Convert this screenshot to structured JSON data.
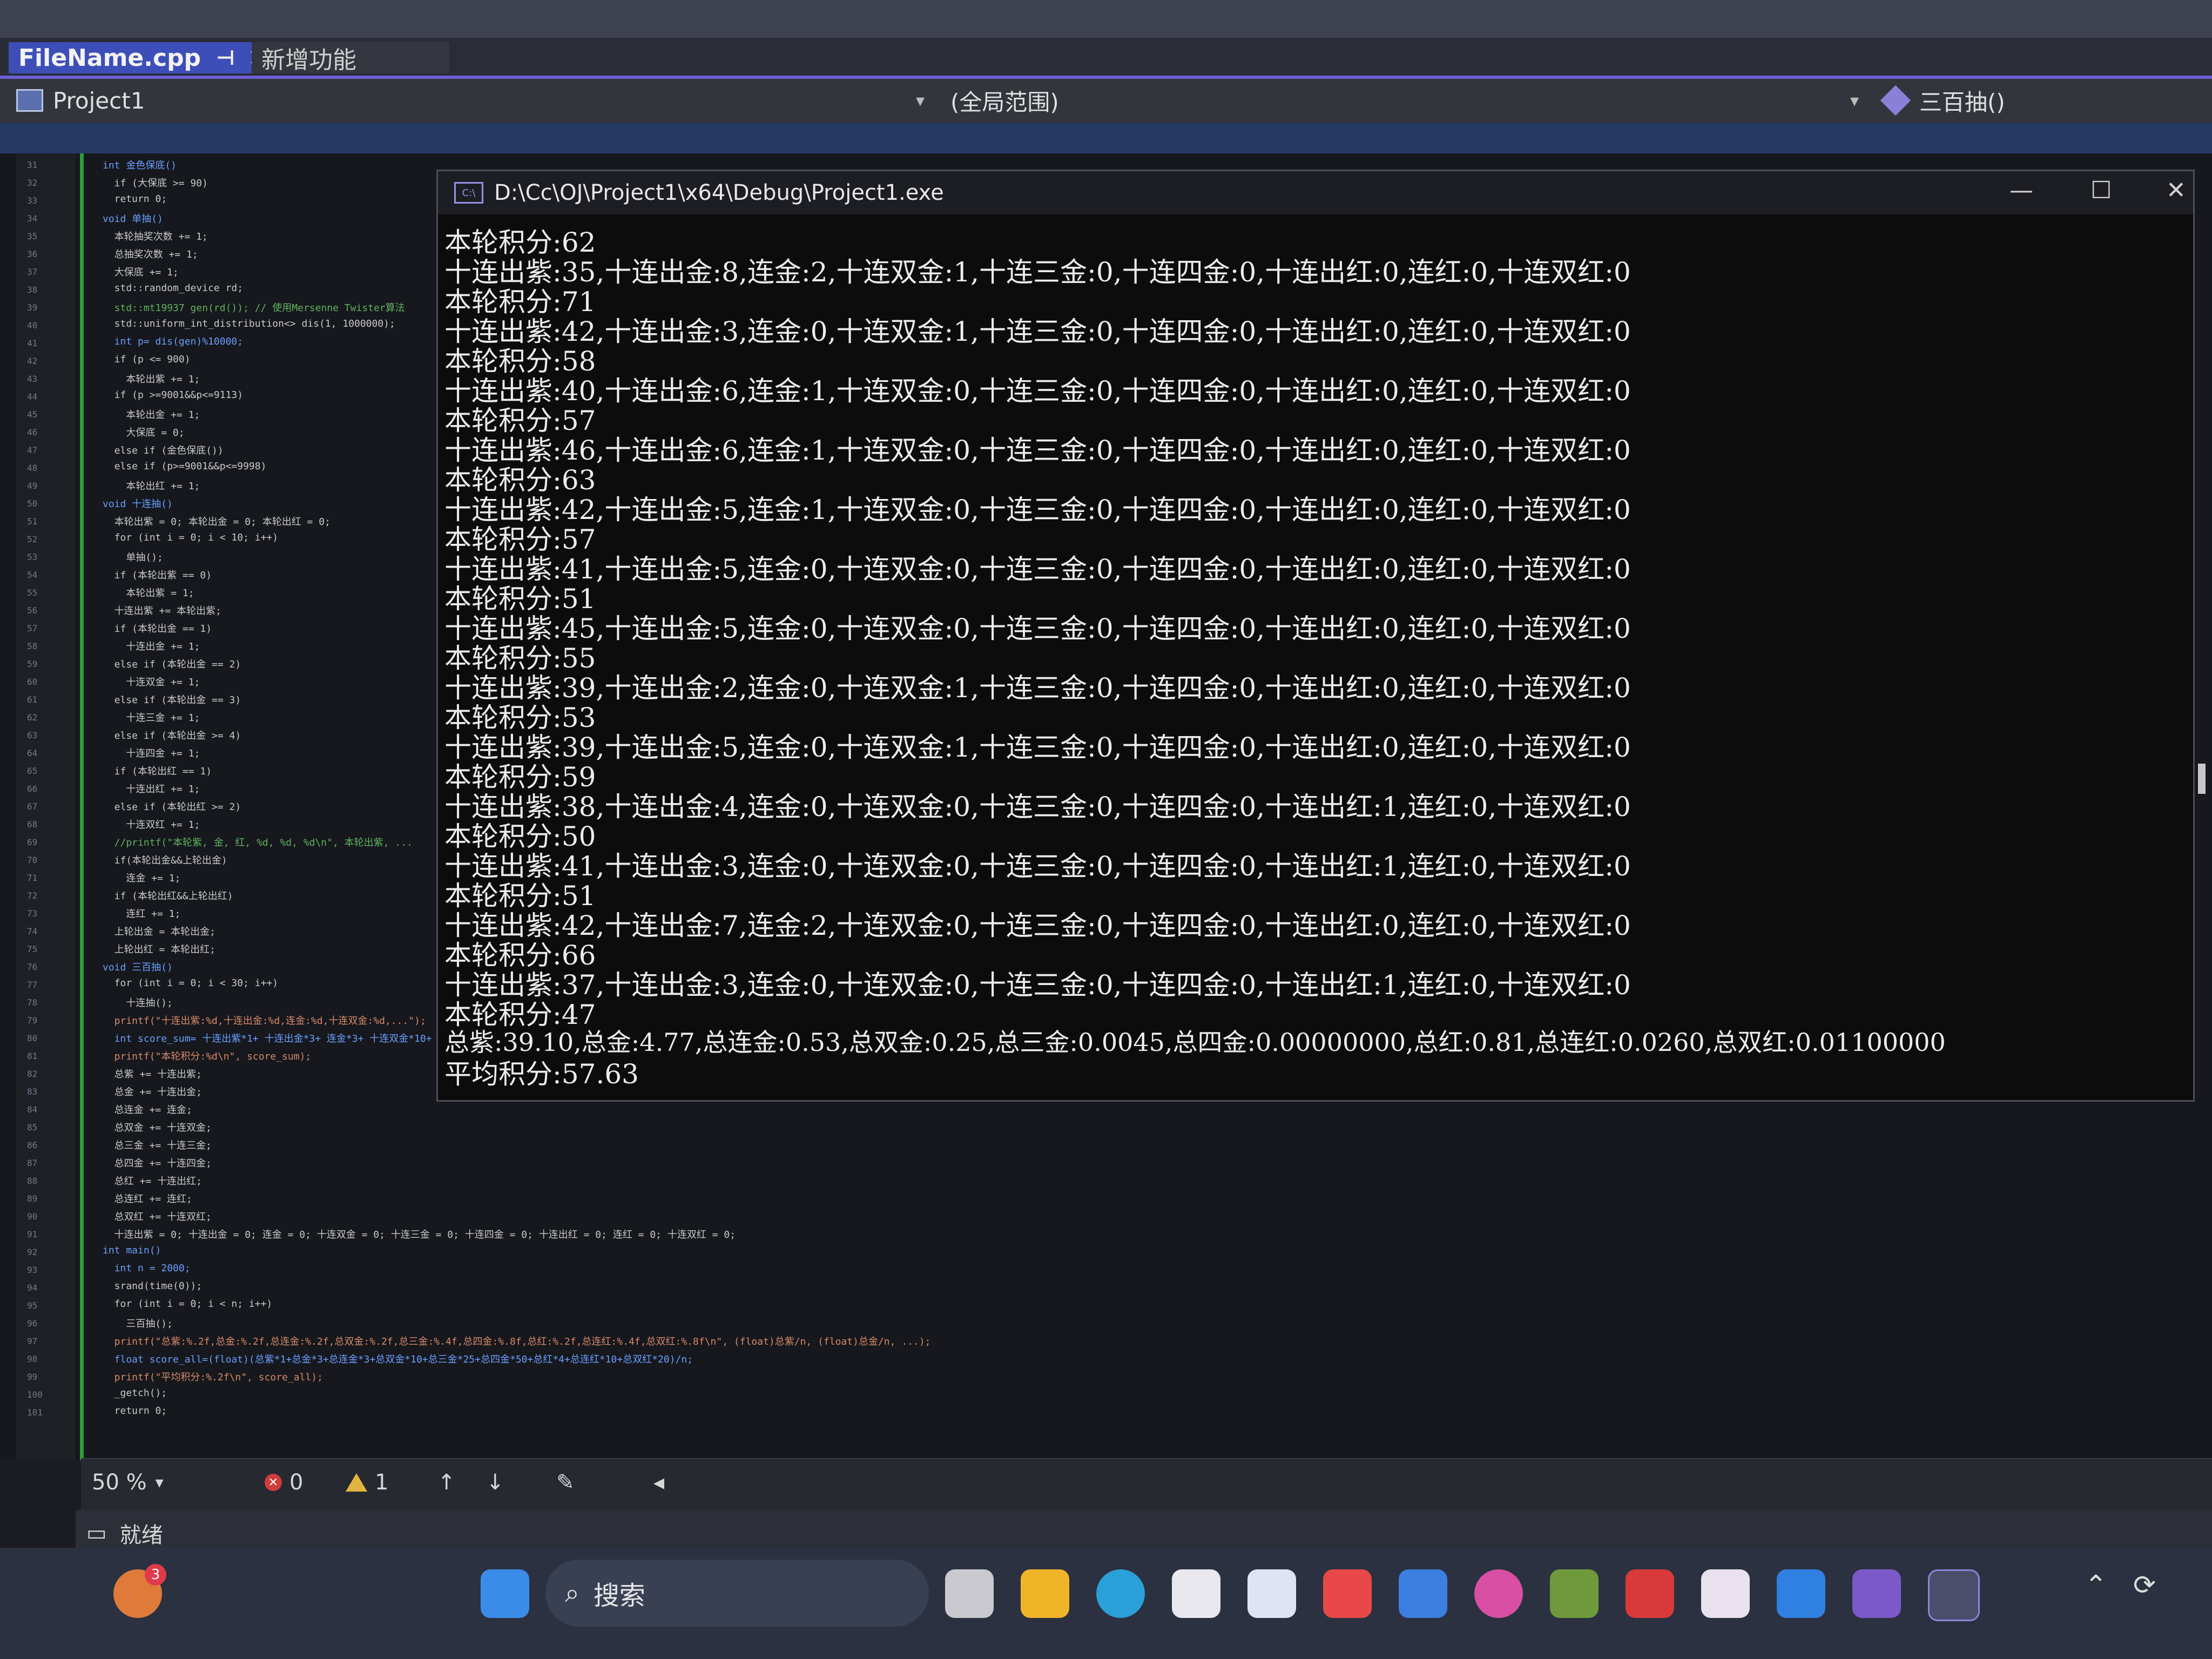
{
  "tabs": [
    {
      "label": "FileName.cpp",
      "pin": "⊣",
      "close": "✕"
    },
    {
      "label": "新增功能"
    }
  ],
  "nav": {
    "project": "Project1",
    "scope": "(全局范围)",
    "member": "三百抽()"
  },
  "code_lines": [
    {
      "text": "int 金色保底()"
    },
    {
      "text": "  if (大保底 >= 90)"
    },
    {
      "text": "  return 0;"
    },
    {
      "text": "void 单抽()"
    },
    {
      "text": "  本轮抽奖次数 += 1;"
    },
    {
      "text": "  总抽奖次数 += 1;"
    },
    {
      "text": "  大保底 += 1;"
    },
    {
      "text": "  std::random_device rd;"
    },
    {
      "text": "  std::mt19937 gen(rd()); // 使用Mersenne Twister算法"
    },
    {
      "text": "  std::uniform_int_distribution<> dis(1, 1000000);"
    },
    {
      "text": "  int p= dis(gen)%10000;"
    },
    {
      "text": "  if (p <= 900)"
    },
    {
      "text": "    本轮出紫 += 1;"
    },
    {
      "text": "  if (p >=9001&&p<=9113)"
    },
    {
      "text": "    本轮出金 += 1;"
    },
    {
      "text": "    大保底 = 0;"
    },
    {
      "text": "  else if (金色保底())"
    },
    {
      "text": "  else if (p>=9001&&p<=9998)"
    },
    {
      "text": "    本轮出红 += 1;"
    },
    {
      "text": "void 十连抽()"
    },
    {
      "text": "  本轮出紫 = 0; 本轮出金 = 0; 本轮出红 = 0;"
    },
    {
      "text": "  for (int i = 0; i < 10; i++)"
    },
    {
      "text": "    单抽();"
    },
    {
      "text": "  if (本轮出紫 == 0)"
    },
    {
      "text": "    本轮出紫 = 1;"
    },
    {
      "text": "  十连出紫 += 本轮出紫;"
    },
    {
      "text": "  if (本轮出金 == 1)"
    },
    {
      "text": "    十连出金 += 1;"
    },
    {
      "text": "  else if (本轮出金 == 2)"
    },
    {
      "text": "    十连双金 += 1;"
    },
    {
      "text": "  else if (本轮出金 == 3)"
    },
    {
      "text": "    十连三金 += 1;"
    },
    {
      "text": "  else if (本轮出金 >= 4)"
    },
    {
      "text": "    十连四金 += 1;"
    },
    {
      "text": "  if (本轮出红 == 1)"
    },
    {
      "text": "    十连出红 += 1;"
    },
    {
      "text": "  else if (本轮出红 >= 2)"
    },
    {
      "text": "    十连双红 += 1;"
    },
    {
      "text": "  //printf(\"本轮紫, 金, 红, %d, %d, %d\\n\", 本轮出紫, ..."
    },
    {
      "text": "  if(本轮出金&&上轮出金)"
    },
    {
      "text": "    连金 += 1;"
    },
    {
      "text": "  if (本轮出红&&上轮出红)"
    },
    {
      "text": "    连红 += 1;"
    },
    {
      "text": "  上轮出金 = 本轮出金;"
    },
    {
      "text": "  上轮出红 = 本轮出红;"
    },
    {
      "text": "void 三百抽()"
    },
    {
      "text": "  for (int i = 0; i < 30; i++)"
    },
    {
      "text": "    十连抽();"
    },
    {
      "text": "  printf(\"十连出紫:%d,十连出金:%d,连金:%d,十连双金:%d,...\");"
    },
    {
      "text": "  int score_sum= 十连出紫*1+ 十连出金*3+ 连金*3+ 十连双金*10+ 十连三金*25+ 十连四金*50+ 十连出红*4+ 连红*10+ 十连双红*20;"
    },
    {
      "text": "  printf(\"本轮积分:%d\\n\", score_sum);"
    },
    {
      "text": "  总紫 += 十连出紫;"
    },
    {
      "text": "  总金 += 十连出金;"
    },
    {
      "text": "  总连金 += 连金;"
    },
    {
      "text": "  总双金 += 十连双金;"
    },
    {
      "text": "  总三金 += 十连三金;"
    },
    {
      "text": "  总四金 += 十连四金;"
    },
    {
      "text": "  总红 += 十连出红;"
    },
    {
      "text": "  总连红 += 连红;"
    },
    {
      "text": "  总双红 += 十连双红;"
    },
    {
      "text": "  十连出紫 = 0; 十连出金 = 0; 连金 = 0; 十连双金 = 0; 十连三金 = 0; 十连四金 = 0; 十连出红 = 0; 连红 = 0; 十连双红 = 0;"
    },
    {
      "text": "int main()"
    },
    {
      "text": "  int n = 2000;"
    },
    {
      "text": "  srand(time(0));"
    },
    {
      "text": "  for (int i = 0; i < n; i++)"
    },
    {
      "text": "    三百抽();"
    },
    {
      "text": "  printf(\"总紫:%.2f,总金:%.2f,总连金:%.2f,总双金:%.2f,总三金:%.4f,总四金:%.8f,总红:%.2f,总连红:%.4f,总双红:%.8f\\n\", (float)总紫/n, (float)总金/n, ...);"
    },
    {
      "text": "  float score_all=(float)(总紫*1+总金*3+总连金*3+总双金*10+总三金*25+总四金*50+总红*4+总连红*10+总双红*20)/n;"
    },
    {
      "text": "  printf(\"平均积分:%.2f\\n\", score_all);"
    },
    {
      "text": "  _getch();"
    },
    {
      "text": "  return 0;"
    }
  ],
  "console": {
    "title": "D:\\Cc\\OJ\\Project1\\x64\\Debug\\Project1.exe",
    "icon_text": "C:\\",
    "controls": {
      "minimize": "—",
      "maximize": "☐",
      "close": "✕"
    },
    "lines": [
      "本轮积分:62",
      "十连出紫:35,十连出金:8,连金:2,十连双金:1,十连三金:0,十连四金:0,十连出红:0,连红:0,十连双红:0",
      "本轮积分:71",
      "十连出紫:42,十连出金:3,连金:0,十连双金:1,十连三金:0,十连四金:0,十连出红:0,连红:0,十连双红:0",
      "本轮积分:58",
      "十连出紫:40,十连出金:6,连金:1,十连双金:0,十连三金:0,十连四金:0,十连出红:0,连红:0,十连双红:0",
      "本轮积分:57",
      "十连出紫:46,十连出金:6,连金:1,十连双金:0,十连三金:0,十连四金:0,十连出红:0,连红:0,十连双红:0",
      "本轮积分:63",
      "十连出紫:42,十连出金:5,连金:1,十连双金:0,十连三金:0,十连四金:0,十连出红:0,连红:0,十连双红:0",
      "本轮积分:57",
      "十连出紫:41,十连出金:5,连金:0,十连双金:0,十连三金:0,十连四金:0,十连出红:0,连红:0,十连双红:0",
      "本轮积分:51",
      "十连出紫:45,十连出金:5,连金:0,十连双金:0,十连三金:0,十连四金:0,十连出红:0,连红:0,十连双红:0",
      "本轮积分:55",
      "十连出紫:39,十连出金:2,连金:0,十连双金:1,十连三金:0,十连四金:0,十连出红:0,连红:0,十连双红:0",
      "本轮积分:53",
      "十连出紫:39,十连出金:5,连金:0,十连双金:1,十连三金:0,十连四金:0,十连出红:0,连红:0,十连双红:0",
      "本轮积分:59",
      "十连出紫:38,十连出金:4,连金:0,十连双金:0,十连三金:0,十连四金:0,十连出红:1,连红:0,十连双红:0",
      "本轮积分:50",
      "十连出紫:41,十连出金:3,连金:0,十连双金:0,十连三金:0,十连四金:0,十连出红:1,连红:0,十连双红:0",
      "本轮积分:51",
      "十连出紫:42,十连出金:7,连金:2,十连双金:0,十连三金:0,十连四金:0,十连出红:0,连红:0,十连双红:0",
      "本轮积分:66",
      "十连出紫:37,十连出金:3,连金:0,十连双金:0,十连三金:0,十连四金:0,十连出红:1,连红:0,十连双红:0",
      "本轮积分:47",
      "总紫:39.10,总金:4.77,总连金:0.53,总双金:0.25,总三金:0.0045,总四金:0.00000000,总红:0.81,总连红:0.0260,总双红:0.01100000",
      "平均积分:57.63"
    ]
  },
  "status": {
    "zoom": "50 %",
    "errors": "0",
    "warnings": "1",
    "ready": "就绪"
  },
  "taskbar": {
    "notification_badge": "3",
    "search_label": "搜索",
    "icons": [
      "start-icon",
      "search-icon",
      "task-view-icon",
      "file-explorer-icon",
      "edge-icon",
      "store-icon",
      "office-icon",
      "app-red-icon",
      "cloud-icon",
      "color-wheel-icon",
      "minecraft-icon",
      "wps-icon",
      "qq-icon",
      "baidu-netdisk-icon",
      "visual-studio-icon",
      "terminal-icon"
    ],
    "colors": {
      "accent": "#6c5fd6",
      "tab_active": "#3e4eb8",
      "console_bg": "#0c0c0c",
      "editor_bg": "#16181d"
    }
  }
}
